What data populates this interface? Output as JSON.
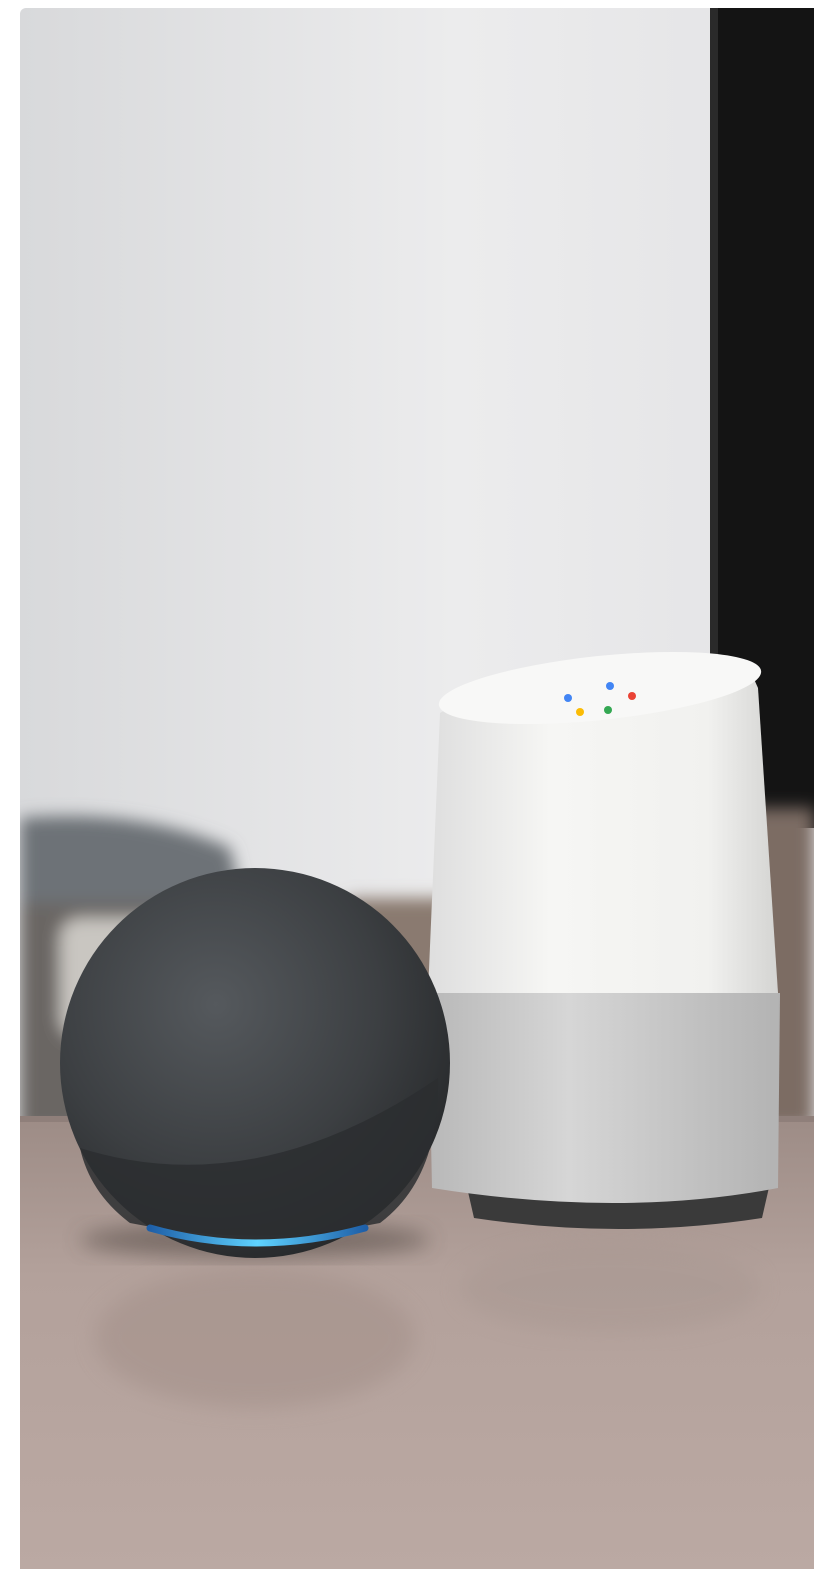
{
  "image": {
    "subject": "smart-speakers",
    "palette": {
      "wall": "#e9e9ea",
      "wall_shadow": "#cfd0d2",
      "dark_panel": "#141414",
      "table": "#b09e98",
      "table_shadow": "#8f7f7a",
      "sofa": "#6f7479",
      "echo_fabric": "#3e4144",
      "echo_ring": "#4fc3f7",
      "home_top": "#f2f2f0",
      "home_base": "#c9c9c9",
      "home_foot": "#3a3a3a",
      "led_blue": "#4285f4",
      "led_red": "#ea4335",
      "led_yellow": "#fbbc05",
      "led_green": "#34a853"
    }
  }
}
